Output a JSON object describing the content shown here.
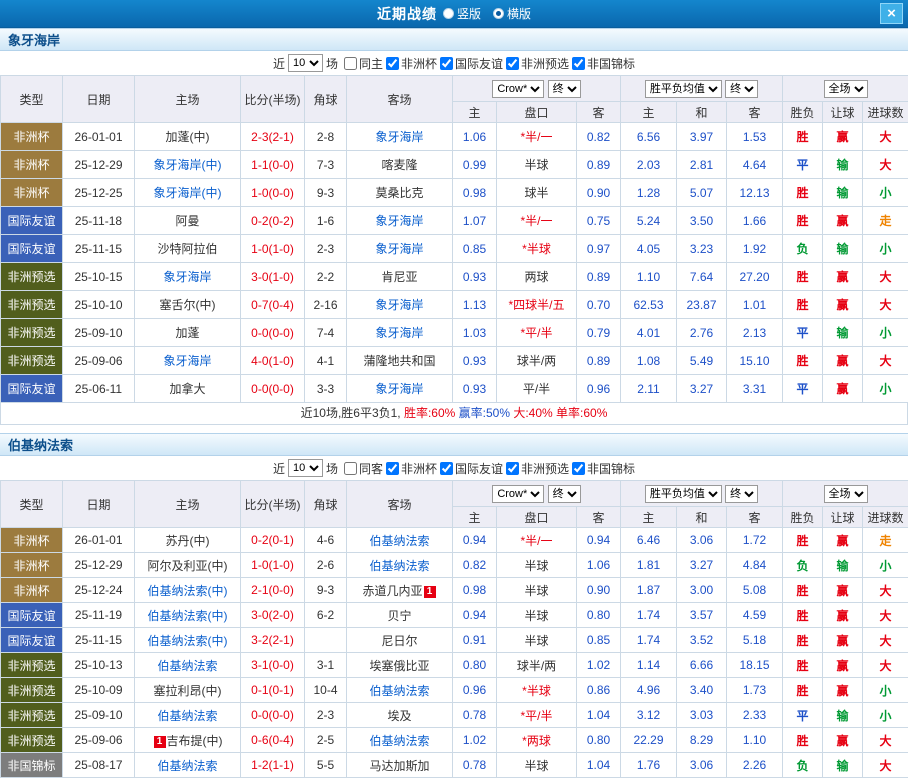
{
  "titlebar": {
    "title": "近期战绩",
    "layout_options": [
      {
        "label": "竖版",
        "selected": false
      },
      {
        "label": "横版",
        "selected": true
      }
    ],
    "close_icon": "×"
  },
  "filter": {
    "near": "近",
    "count": "10",
    "games": "场"
  },
  "header": {
    "type": "类型",
    "date": "日期",
    "home": "主场",
    "score": "比分(半场)",
    "corner": "角球",
    "away": "客场",
    "odds_source": "Crow*",
    "final": "终",
    "avg_label": "胜平负均值",
    "full": "全场",
    "sub": [
      "主",
      "盘口",
      "客",
      "主",
      "和",
      "客",
      "胜负",
      "让球",
      "进球数"
    ]
  },
  "colors": {
    "type": {
      "非洲杯": "#9c7b3e",
      "国际友谊": "#3a61b8",
      "非洲预选": "#515e1d",
      "非国锦标": "#7d7d7d"
    },
    "semantic": {
      "胜": "#e60012",
      "平": "#1d50c8",
      "负": "#009933",
      "赢": "#e60012",
      "输": "#009933",
      "大": "#e60012",
      "小": "#009933",
      "走": "#ef8300"
    },
    "focus_team": "#0a5fce",
    "odds": "#1d50c8",
    "score": "#e60012"
  },
  "sections": [
    {
      "team": "象牙海岸",
      "filters": [
        {
          "label": "同主",
          "checked": false
        },
        {
          "label": "非洲杯",
          "checked": true
        },
        {
          "label": "国际友谊",
          "checked": true
        },
        {
          "label": "非洲预选",
          "checked": true
        },
        {
          "label": "非国锦标",
          "checked": true
        }
      ],
      "rows": [
        {
          "type": "非洲杯",
          "date": "26-01-01",
          "home": "加蓬(中)",
          "score": "2-3(2-1)",
          "corner": "2-8",
          "away": "象牙海岸",
          "odds": [
            "1.06",
            "*半/一",
            "0.82"
          ],
          "avg": [
            "6.56",
            "3.97",
            "1.53"
          ],
          "res": [
            "胜",
            "赢",
            "大"
          ]
        },
        {
          "type": "非洲杯",
          "date": "25-12-29",
          "home": "象牙海岸(中)",
          "score": "1-1(0-0)",
          "corner": "7-3",
          "away": "喀麦隆",
          "odds": [
            "0.99",
            "半球",
            "0.89"
          ],
          "avg": [
            "2.03",
            "2.81",
            "4.64"
          ],
          "res": [
            "平",
            "输",
            "大"
          ]
        },
        {
          "type": "非洲杯",
          "date": "25-12-25",
          "home": "象牙海岸(中)",
          "score": "1-0(0-0)",
          "corner": "9-3",
          "away": "莫桑比克",
          "odds": [
            "0.98",
            "球半",
            "0.90"
          ],
          "avg": [
            "1.28",
            "5.07",
            "12.13"
          ],
          "res": [
            "胜",
            "输",
            "小"
          ]
        },
        {
          "type": "国际友谊",
          "date": "25-11-18",
          "home": "阿曼",
          "score": "0-2(0-2)",
          "corner": "1-6",
          "away": "象牙海岸",
          "odds": [
            "1.07",
            "*半/一",
            "0.75"
          ],
          "avg": [
            "5.24",
            "3.50",
            "1.66"
          ],
          "res": [
            "胜",
            "赢",
            "走"
          ]
        },
        {
          "type": "国际友谊",
          "date": "25-11-15",
          "home": "沙特阿拉伯",
          "score": "1-0(1-0)",
          "corner": "2-3",
          "away": "象牙海岸",
          "odds": [
            "0.85",
            "*半球",
            "0.97"
          ],
          "avg": [
            "4.05",
            "3.23",
            "1.92"
          ],
          "res": [
            "负",
            "输",
            "小"
          ]
        },
        {
          "type": "非洲预选",
          "date": "25-10-15",
          "home": "象牙海岸",
          "score": "3-0(1-0)",
          "corner": "2-2",
          "away": "肯尼亚",
          "odds": [
            "0.93",
            "两球",
            "0.89"
          ],
          "avg": [
            "1.10",
            "7.64",
            "27.20"
          ],
          "res": [
            "胜",
            "赢",
            "大"
          ]
        },
        {
          "type": "非洲预选",
          "date": "25-10-10",
          "home": "塞舌尔(中)",
          "score": "0-7(0-4)",
          "corner": "2-16",
          "away": "象牙海岸",
          "odds": [
            "1.13",
            "*四球半/五",
            "0.70"
          ],
          "avg": [
            "62.53",
            "23.87",
            "1.01"
          ],
          "res": [
            "胜",
            "赢",
            "大"
          ]
        },
        {
          "type": "非洲预选",
          "date": "25-09-10",
          "home": "加蓬",
          "score": "0-0(0-0)",
          "corner": "7-4",
          "away": "象牙海岸",
          "odds": [
            "1.03",
            "*平/半",
            "0.79"
          ],
          "avg": [
            "4.01",
            "2.76",
            "2.13"
          ],
          "res": [
            "平",
            "输",
            "小"
          ]
        },
        {
          "type": "非洲预选",
          "date": "25-09-06",
          "home": "象牙海岸",
          "score": "4-0(1-0)",
          "corner": "4-1",
          "away": "蒲隆地共和国",
          "odds": [
            "0.93",
            "球半/两",
            "0.89"
          ],
          "avg": [
            "1.08",
            "5.49",
            "15.10"
          ],
          "res": [
            "胜",
            "赢",
            "大"
          ]
        },
        {
          "type": "国际友谊",
          "date": "25-06-11",
          "home": "加拿大",
          "score": "0-0(0-0)",
          "corner": "3-3",
          "away": "象牙海岸",
          "odds": [
            "0.93",
            "平/半",
            "0.96"
          ],
          "avg": [
            "2.11",
            "3.27",
            "3.31"
          ],
          "res": [
            "平",
            "赢",
            "小"
          ]
        }
      ],
      "summary": [
        {
          "text": "近10场,胜6平3负1, ",
          "color": "#333333"
        },
        {
          "text": "胜率:60% ",
          "color": "#e60012"
        },
        {
          "text": "赢率:50% ",
          "color": "#1d50c8"
        },
        {
          "text": "大:40% ",
          "color": "#e60012"
        },
        {
          "text": "单率:60%",
          "color": "#e60012"
        }
      ]
    },
    {
      "team": "伯基纳法索",
      "filters": [
        {
          "label": "同客",
          "checked": false
        },
        {
          "label": "非洲杯",
          "checked": true
        },
        {
          "label": "国际友谊",
          "checked": true
        },
        {
          "label": "非洲预选",
          "checked": true
        },
        {
          "label": "非国锦标",
          "checked": true
        }
      ],
      "rows": [
        {
          "type": "非洲杯",
          "date": "26-01-01",
          "home": "苏丹(中)",
          "score": "0-2(0-1)",
          "corner": "4-6",
          "away": "伯基纳法索",
          "odds": [
            "0.94",
            "*半/一",
            "0.94"
          ],
          "avg": [
            "6.46",
            "3.06",
            "1.72"
          ],
          "res": [
            "胜",
            "赢",
            "走"
          ]
        },
        {
          "type": "非洲杯",
          "date": "25-12-29",
          "home": "阿尔及利亚(中)",
          "score": "1-0(1-0)",
          "corner": "2-6",
          "away": "伯基纳法索",
          "odds": [
            "0.82",
            "半球",
            "1.06"
          ],
          "avg": [
            "1.81",
            "3.27",
            "4.84"
          ],
          "res": [
            "负",
            "输",
            "小"
          ]
        },
        {
          "type": "非洲杯",
          "date": "25-12-24",
          "home": "伯基纳法索(中)",
          "score": "2-1(0-0)",
          "corner": "9-3",
          "away": "赤道几内亚",
          "away_rc": "1",
          "odds": [
            "0.98",
            "半球",
            "0.90"
          ],
          "avg": [
            "1.87",
            "3.00",
            "5.08"
          ],
          "res": [
            "胜",
            "赢",
            "大"
          ]
        },
        {
          "type": "国际友谊",
          "date": "25-11-19",
          "home": "伯基纳法索(中)",
          "score": "3-0(2-0)",
          "corner": "6-2",
          "away": "贝宁",
          "odds": [
            "0.94",
            "半球",
            "0.80"
          ],
          "avg": [
            "1.74",
            "3.57",
            "4.59"
          ],
          "res": [
            "胜",
            "赢",
            "大"
          ]
        },
        {
          "type": "国际友谊",
          "date": "25-11-15",
          "home": "伯基纳法索(中)",
          "score": "3-2(2-1)",
          "corner": "",
          "away": "尼日尔",
          "odds": [
            "0.91",
            "半球",
            "0.85"
          ],
          "avg": [
            "1.74",
            "3.52",
            "5.18"
          ],
          "res": [
            "胜",
            "赢",
            "大"
          ]
        },
        {
          "type": "非洲预选",
          "date": "25-10-13",
          "home": "伯基纳法索",
          "score": "3-1(0-0)",
          "corner": "3-1",
          "away": "埃塞俄比亚",
          "odds": [
            "0.80",
            "球半/两",
            "1.02"
          ],
          "avg": [
            "1.14",
            "6.66",
            "18.15"
          ],
          "res": [
            "胜",
            "赢",
            "大"
          ]
        },
        {
          "type": "非洲预选",
          "date": "25-10-09",
          "home": "塞拉利昂(中)",
          "score": "0-1(0-1)",
          "corner": "10-4",
          "away": "伯基纳法索",
          "odds": [
            "0.96",
            "*半球",
            "0.86"
          ],
          "avg": [
            "4.96",
            "3.40",
            "1.73"
          ],
          "res": [
            "胜",
            "赢",
            "小"
          ]
        },
        {
          "type": "非洲预选",
          "date": "25-09-10",
          "home": "伯基纳法索",
          "score": "0-0(0-0)",
          "corner": "2-3",
          "away": "埃及",
          "odds": [
            "0.78",
            "*平/半",
            "1.04"
          ],
          "avg": [
            "3.12",
            "3.03",
            "2.33"
          ],
          "res": [
            "平",
            "输",
            "小"
          ]
        },
        {
          "type": "非洲预选",
          "date": "25-09-06",
          "home": "吉布提(中)",
          "home_rc": "1",
          "score": "0-6(0-4)",
          "corner": "2-5",
          "away": "伯基纳法索",
          "odds": [
            "1.02",
            "*两球",
            "0.80"
          ],
          "avg": [
            "22.29",
            "8.29",
            "1.10"
          ],
          "res": [
            "胜",
            "赢",
            "大"
          ]
        },
        {
          "type": "非国锦标",
          "date": "25-08-17",
          "home": "伯基纳法索",
          "score": "1-2(1-1)",
          "corner": "5-5",
          "away": "马达加斯加",
          "odds": [
            "0.78",
            "半球",
            "1.04"
          ],
          "avg": [
            "1.76",
            "3.06",
            "2.26"
          ],
          "res": [
            "负",
            "输",
            "大"
          ]
        }
      ],
      "summary": []
    }
  ]
}
